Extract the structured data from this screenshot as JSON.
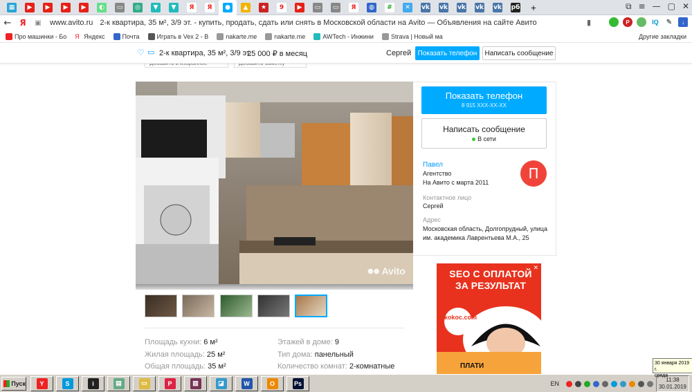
{
  "browser": {
    "tabs": [
      {
        "icon": "playlist-icon",
        "color": "#2aa3d6",
        "glyph": "▦"
      },
      {
        "icon": "youtube-icon",
        "color": "#e62117",
        "glyph": "▶"
      },
      {
        "icon": "youtube-icon",
        "color": "#e62117",
        "glyph": "▶"
      },
      {
        "icon": "youtube-icon",
        "color": "#e62117",
        "glyph": "▶"
      },
      {
        "icon": "youtube-icon",
        "color": "#e62117",
        "glyph": "▶"
      },
      {
        "icon": "circle-icon",
        "color": "#6d8",
        "glyph": "◐"
      },
      {
        "icon": "document-icon",
        "color": "#888",
        "glyph": "▭"
      },
      {
        "icon": "circle-icon",
        "color": "#3a8",
        "glyph": "◎"
      },
      {
        "icon": "triangle-icon",
        "color": "#2bb",
        "glyph": "▼"
      },
      {
        "icon": "triangle-icon",
        "color": "#2bb",
        "glyph": "▼"
      },
      {
        "icon": "yandex-icon",
        "color": "#fff",
        "glyph": "Я",
        "text_color": "#e22"
      },
      {
        "icon": "yandex-icon",
        "color": "#fff",
        "glyph": "Я",
        "text_color": "#e22"
      },
      {
        "icon": "avito-icon",
        "color": "#0af",
        "glyph": "●",
        "active": true
      },
      {
        "icon": "image-icon",
        "color": "#f3b400",
        "glyph": "▲"
      },
      {
        "icon": "flag-icon",
        "color": "#c22",
        "glyph": "★"
      },
      {
        "icon": "nine-icon",
        "color": "#fff",
        "glyph": "9",
        "text_color": "#e22"
      },
      {
        "icon": "youtube-icon",
        "color": "#e62117",
        "glyph": "▶"
      },
      {
        "icon": "document-icon",
        "color": "#888",
        "glyph": "▭"
      },
      {
        "icon": "document-icon",
        "color": "#888",
        "glyph": "▭"
      },
      {
        "icon": "yandex-icon",
        "color": "#fff",
        "glyph": "Я",
        "text_color": "#e22"
      },
      {
        "icon": "globe-icon",
        "color": "#36c",
        "glyph": "◍"
      },
      {
        "icon": "hash-icon",
        "color": "#fff",
        "glyph": "#",
        "text_color": "#2a2"
      },
      {
        "icon": "x-icon",
        "color": "#4ae",
        "glyph": "✕"
      },
      {
        "icon": "vk-icon",
        "color": "#4a76a8",
        "glyph": "vk"
      },
      {
        "icon": "vk-icon",
        "color": "#4a76a8",
        "glyph": "vk"
      },
      {
        "icon": "vk-icon",
        "color": "#4a76a8",
        "glyph": "vk"
      },
      {
        "icon": "vk-icon",
        "color": "#4a76a8",
        "glyph": "vk"
      },
      {
        "icon": "vk-icon",
        "color": "#4a76a8",
        "glyph": "vk"
      },
      {
        "icon": "rb-icon",
        "color": "#222",
        "glyph": "рб"
      }
    ],
    "new_tab": "+",
    "url_host": "www.avito.ru",
    "url_title": "2-к квартира, 35 м², 3/9 эт. - купить, продать, сдать или снять в Московской области на Avito — Объявления на сайте Авито",
    "bookmarks": [
      {
        "label": "Про машинки - Бо",
        "color": "#e22"
      },
      {
        "label": "Яндекс",
        "color": "#fff",
        "text": "Я"
      },
      {
        "label": "Почта",
        "color": "#36c"
      },
      {
        "label": "Играть в Vex 2 - В",
        "color": "#555"
      },
      {
        "label": "nakarte.me",
        "color": "#999"
      },
      {
        "label": "nakarte.me",
        "color": "#999"
      },
      {
        "label": "AWTech - Инжини",
        "color": "#2bb"
      },
      {
        "label": "Strava | Новый ма",
        "color": "#999"
      }
    ],
    "other_bookmarks": "Другие закладки"
  },
  "sticky": {
    "title": "2-к квартира, 35 м², 3/9 эт.",
    "price": "25 000  ₽  в месяц",
    "user": "Сергей",
    "phone_button": "Показать телефон",
    "message_button": "Написать сообщение"
  },
  "actions": {
    "favorite": "Добавить в избранное",
    "note": "Добавить заметку"
  },
  "photo": {
    "watermark": "Avito"
  },
  "params": [
    {
      "label": "Площадь кухни:",
      "value": "6 м²"
    },
    {
      "label": "Этажей в доме:",
      "value": "9"
    },
    {
      "label": "Жилая площадь:",
      "value": "25 м²"
    },
    {
      "label": "Тип дома:",
      "value": "панельный"
    },
    {
      "label": "Общая площадь:",
      "value": "35 м²"
    },
    {
      "label": "Количество комнат:",
      "value": "2-комнатные"
    }
  ],
  "seller": {
    "phone_button": "Показать телефон",
    "phone_masked": "8 915 XXX-XX-XX",
    "message_button": "Написать сообщение",
    "online": "В сети",
    "name": "Павел",
    "type": "Агентство",
    "since": "На Авито с марта 2011",
    "avatar_letter": "П",
    "contact_label": "Контактное лицо",
    "contact_value": "Сергей",
    "address_label": "Адрес",
    "address_value": "Московская область, Долгопрудный, улица им. академика Лаврентьева М.А., 25"
  },
  "ad": {
    "headline_1": "SEO С ОПЛАТОЙ",
    "headline_2": "ЗА РЕЗУЛЬТАТ",
    "logo": "kokoc.com",
    "cta": "ПЛАТИ",
    "close": "✕"
  },
  "tooltip": {
    "line1": "30 января 2019 г.",
    "line2": "среда"
  },
  "taskbar": {
    "start": "Пуск",
    "apps": [
      {
        "icon": "yandex-browser-icon",
        "color": "#e22",
        "glyph": "Y"
      },
      {
        "icon": "skype-icon",
        "color": "#09d",
        "glyph": "S"
      },
      {
        "icon": "info-icon",
        "color": "#222",
        "glyph": "i"
      },
      {
        "icon": "calculator-icon",
        "color": "#6a8",
        "glyph": "▤"
      },
      {
        "icon": "folder-icon",
        "color": "#db4",
        "glyph": "▭"
      },
      {
        "icon": "powerpoint-icon",
        "color": "#d24",
        "glyph": "P"
      },
      {
        "icon": "winrar-icon",
        "color": "#735",
        "glyph": "▥"
      },
      {
        "icon": "image-viewer-icon",
        "color": "#39c",
        "glyph": "◪"
      },
      {
        "icon": "word-icon",
        "color": "#25a",
        "glyph": "W"
      },
      {
        "icon": "outlook-icon",
        "color": "#e80",
        "glyph": "O"
      },
      {
        "icon": "photoshop-icon",
        "color": "#013",
        "glyph": "Ps"
      }
    ],
    "lang": "EN",
    "time": "11:38",
    "date": "30.01.2019"
  }
}
